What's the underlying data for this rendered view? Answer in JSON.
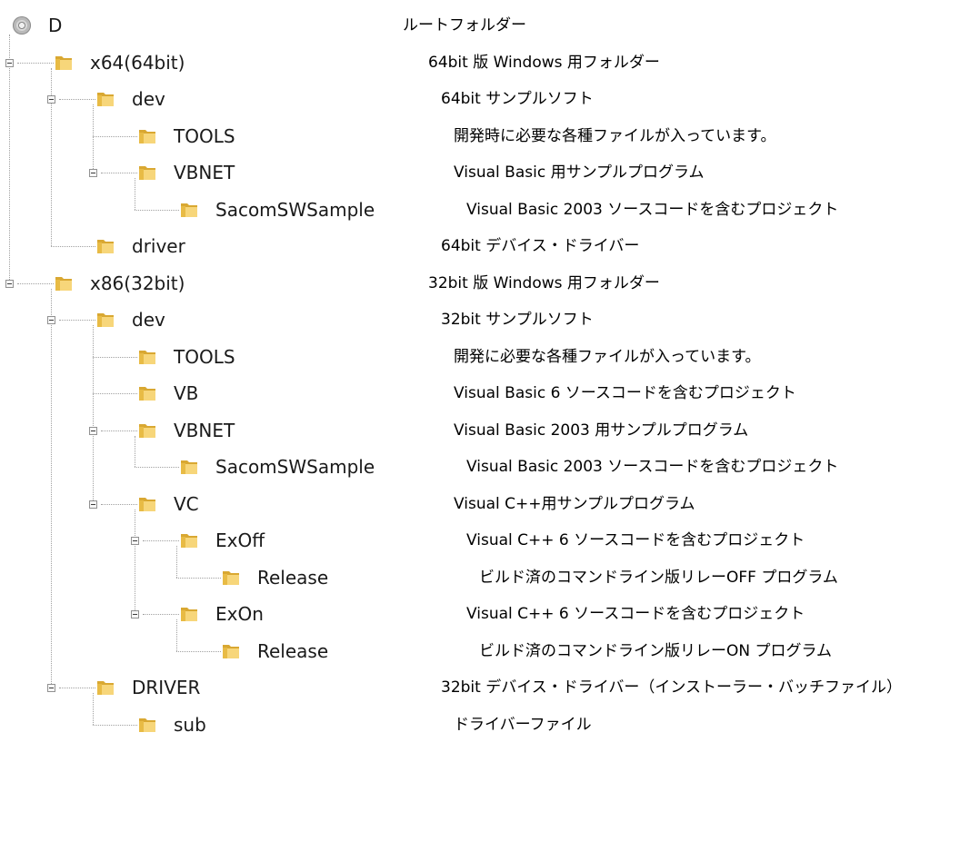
{
  "tree": {
    "nodes": [
      {
        "label": "D",
        "depth": 0,
        "icon": "disc-drive-icon",
        "expander": false,
        "name": "tree-node-d"
      },
      {
        "label": "x64(64bit)",
        "depth": 1,
        "icon": "folder-icon",
        "expander": true,
        "name": "tree-node-x64"
      },
      {
        "label": "dev",
        "depth": 2,
        "icon": "folder-icon",
        "expander": true,
        "name": "tree-node-x64-dev"
      },
      {
        "label": "TOOLS",
        "depth": 3,
        "icon": "folder-icon",
        "expander": false,
        "name": "tree-node-x64-tools"
      },
      {
        "label": "VBNET",
        "depth": 3,
        "icon": "folder-icon",
        "expander": true,
        "name": "tree-node-x64-vbnet"
      },
      {
        "label": "SacomSWSample",
        "depth": 4,
        "icon": "folder-icon",
        "expander": false,
        "name": "tree-node-x64-sacomswsample"
      },
      {
        "label": "driver",
        "depth": 2,
        "icon": "folder-icon",
        "expander": false,
        "name": "tree-node-x64-driver"
      },
      {
        "label": "x86(32bit)",
        "depth": 1,
        "icon": "folder-icon",
        "expander": true,
        "name": "tree-node-x86"
      },
      {
        "label": "dev",
        "depth": 2,
        "icon": "folder-icon",
        "expander": true,
        "name": "tree-node-x86-dev"
      },
      {
        "label": "TOOLS",
        "depth": 3,
        "icon": "folder-icon",
        "expander": false,
        "name": "tree-node-x86-tools"
      },
      {
        "label": "VB",
        "depth": 3,
        "icon": "folder-icon",
        "expander": false,
        "name": "tree-node-x86-vb"
      },
      {
        "label": "VBNET",
        "depth": 3,
        "icon": "folder-icon",
        "expander": true,
        "name": "tree-node-x86-vbnet"
      },
      {
        "label": "SacomSWSample",
        "depth": 4,
        "icon": "folder-icon",
        "expander": false,
        "name": "tree-node-x86-sacomswsample"
      },
      {
        "label": "VC",
        "depth": 3,
        "icon": "folder-icon",
        "expander": true,
        "name": "tree-node-x86-vc"
      },
      {
        "label": "ExOff",
        "depth": 4,
        "icon": "folder-icon",
        "expander": true,
        "name": "tree-node-x86-exoff"
      },
      {
        "label": "Release",
        "depth": 5,
        "icon": "folder-icon",
        "expander": false,
        "name": "tree-node-x86-exoff-release"
      },
      {
        "label": "ExOn",
        "depth": 4,
        "icon": "folder-icon",
        "expander": true,
        "name": "tree-node-x86-exon"
      },
      {
        "label": "Release",
        "depth": 5,
        "icon": "folder-icon",
        "expander": false,
        "name": "tree-node-x86-exon-release"
      },
      {
        "label": "DRIVER",
        "depth": 2,
        "icon": "folder-icon",
        "expander": true,
        "name": "tree-node-x86-driver"
      },
      {
        "label": "sub",
        "depth": 3,
        "icon": "folder-icon",
        "expander": false,
        "name": "tree-node-x86-driver-sub"
      }
    ]
  },
  "descriptions": [
    {
      "text": "ルートフォルダー",
      "indent": 0
    },
    {
      "text": "64bit 版 Windows 用フォルダー",
      "indent": 1
    },
    {
      "text": "64bit サンプルソフト",
      "indent": 2
    },
    {
      "text": "開発時に必要な各種ファイルが入っています。",
      "indent": 3
    },
    {
      "text": "Visual Basic 用サンプルプログラム",
      "indent": 3
    },
    {
      "text": "Visual Basic 2003 ソースコードを含むプロジェクト",
      "indent": 4
    },
    {
      "text": "64bit デバイス・ドライバー",
      "indent": 2
    },
    {
      "text": "32bit 版 Windows 用フォルダー",
      "indent": 1
    },
    {
      "text": "32bit サンプルソフト",
      "indent": 2
    },
    {
      "text": "開発に必要な各種ファイルが入っています。",
      "indent": 3
    },
    {
      "text": "Visual Basic 6 ソースコードを含むプロジェクト",
      "indent": 3
    },
    {
      "text": "Visual Basic 2003 用サンプルプログラム",
      "indent": 3
    },
    {
      "text": "Visual Basic 2003 ソースコードを含むプロジェクト",
      "indent": 4
    },
    {
      "text": "Visual C++用サンプルプログラム",
      "indent": 3
    },
    {
      "text": "Visual C++ 6 ソースコードを含むプロジェクト",
      "indent": 4
    },
    {
      "text": "ビルド済のコマンドライン版リレーOFF プログラム",
      "indent": 5
    },
    {
      "text": "Visual C++ 6 ソースコードを含むプロジェクト",
      "indent": 4
    },
    {
      "text": "ビルド済のコマンドライン版リレーON プログラム",
      "indent": 5
    },
    {
      "text": "32bit デバイス・ドライバー（インストーラー・バッチファイル）",
      "indent": 2
    },
    {
      "text": "ドライバーファイル",
      "indent": 3
    }
  ],
  "colors": {
    "folder_light": "#f7d67a",
    "folder_dark": "#d9a832",
    "folder_tab": "#e8bb45",
    "line": "#a0a0a0",
    "text": "#1a1a1a"
  }
}
